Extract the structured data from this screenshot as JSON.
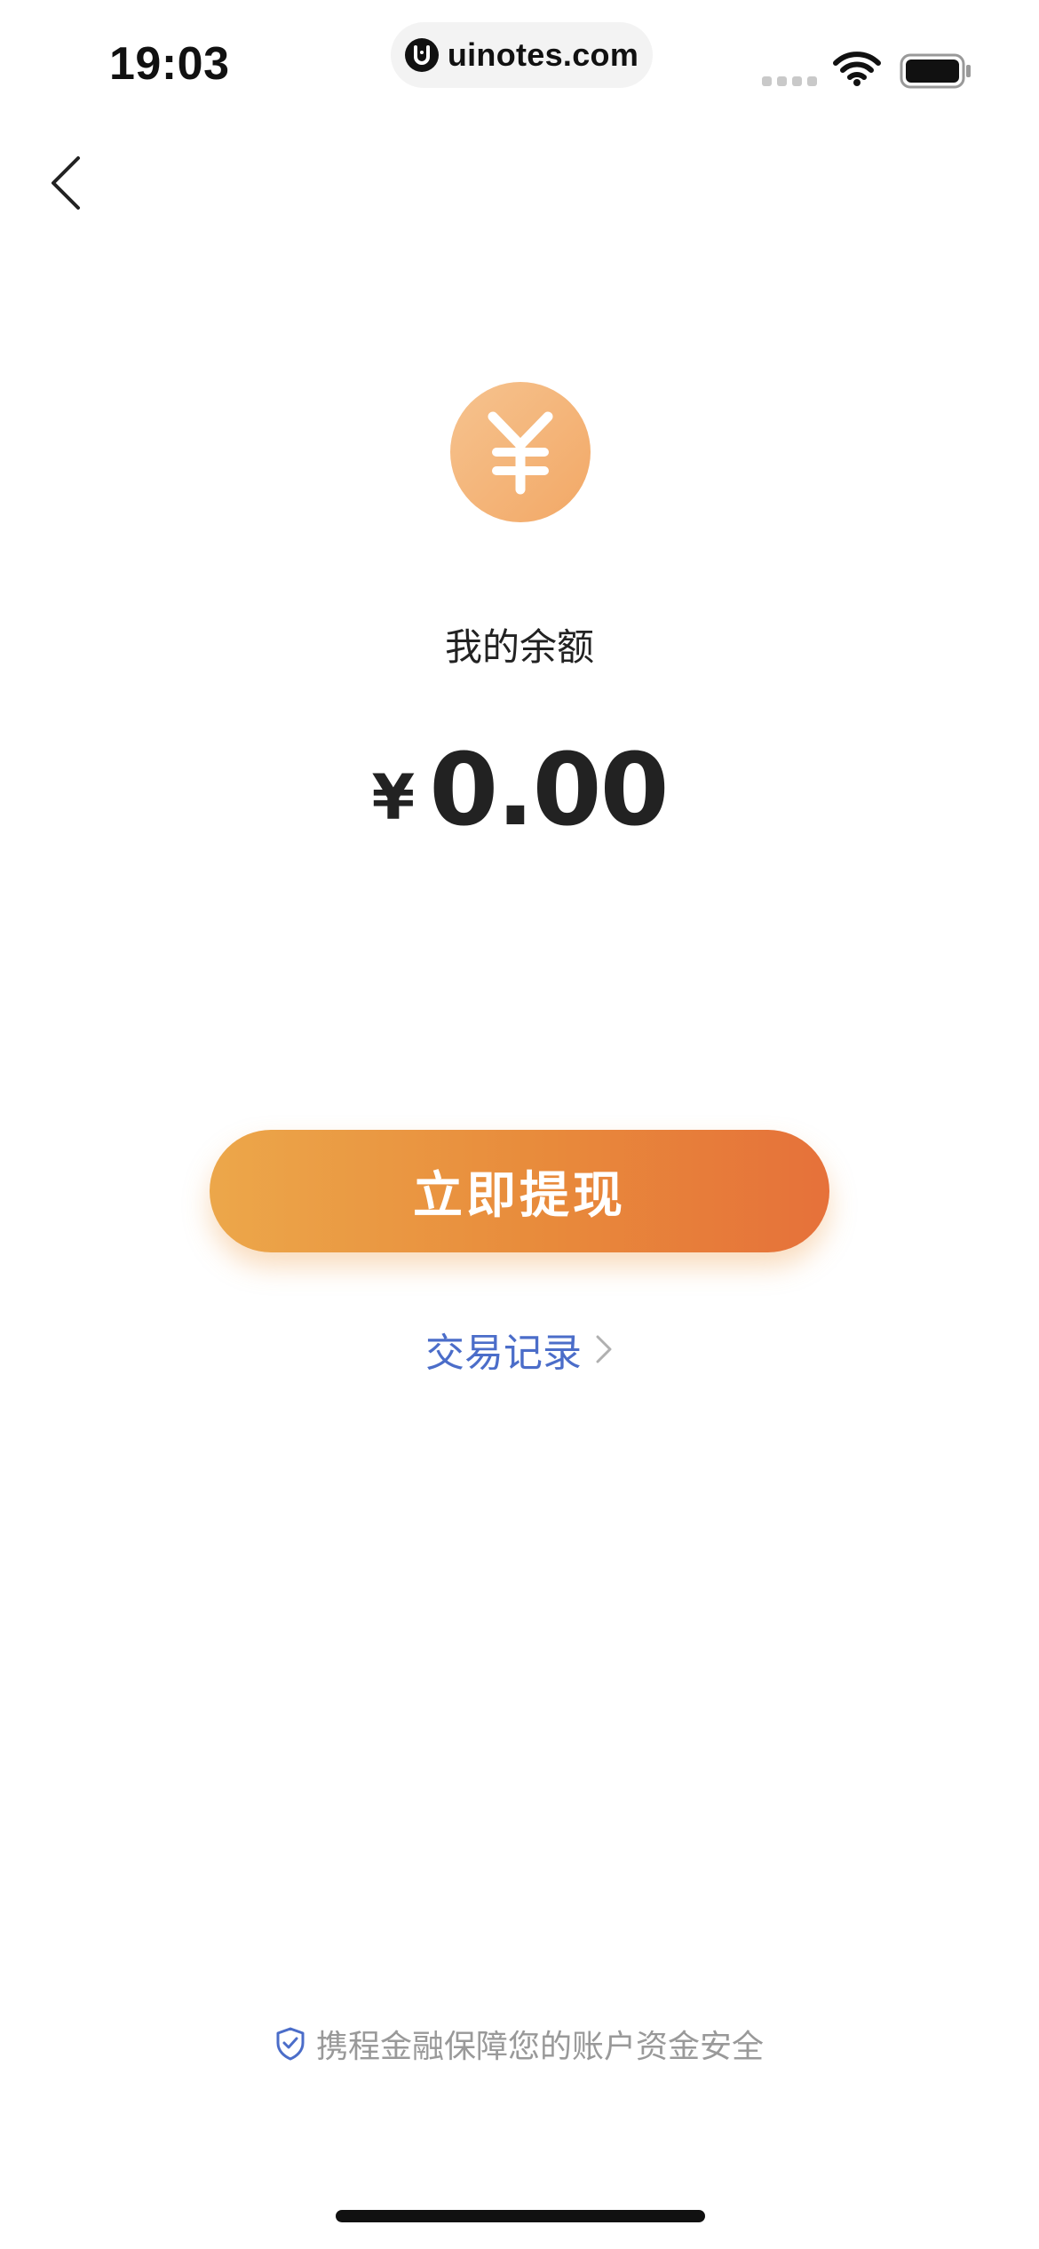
{
  "status_bar": {
    "time": "19:03",
    "url": "uinotes.com"
  },
  "balance": {
    "label": "我的余额",
    "currency_symbol": "¥",
    "amount": "0.00"
  },
  "actions": {
    "withdraw_label": "立即提现",
    "transactions_label": "交易记录"
  },
  "footer": {
    "security_text": "携程金融保障您的账户资金安全"
  },
  "colors": {
    "accent_orange": "#e88a3b",
    "link_blue": "#4b6dc9",
    "muted_gray": "#999999"
  },
  "icons": {
    "back": "chevron-left-icon",
    "coin": "yuan-coin-icon",
    "transactions_arrow": "chevron-right-icon",
    "security": "shield-check-icon"
  }
}
